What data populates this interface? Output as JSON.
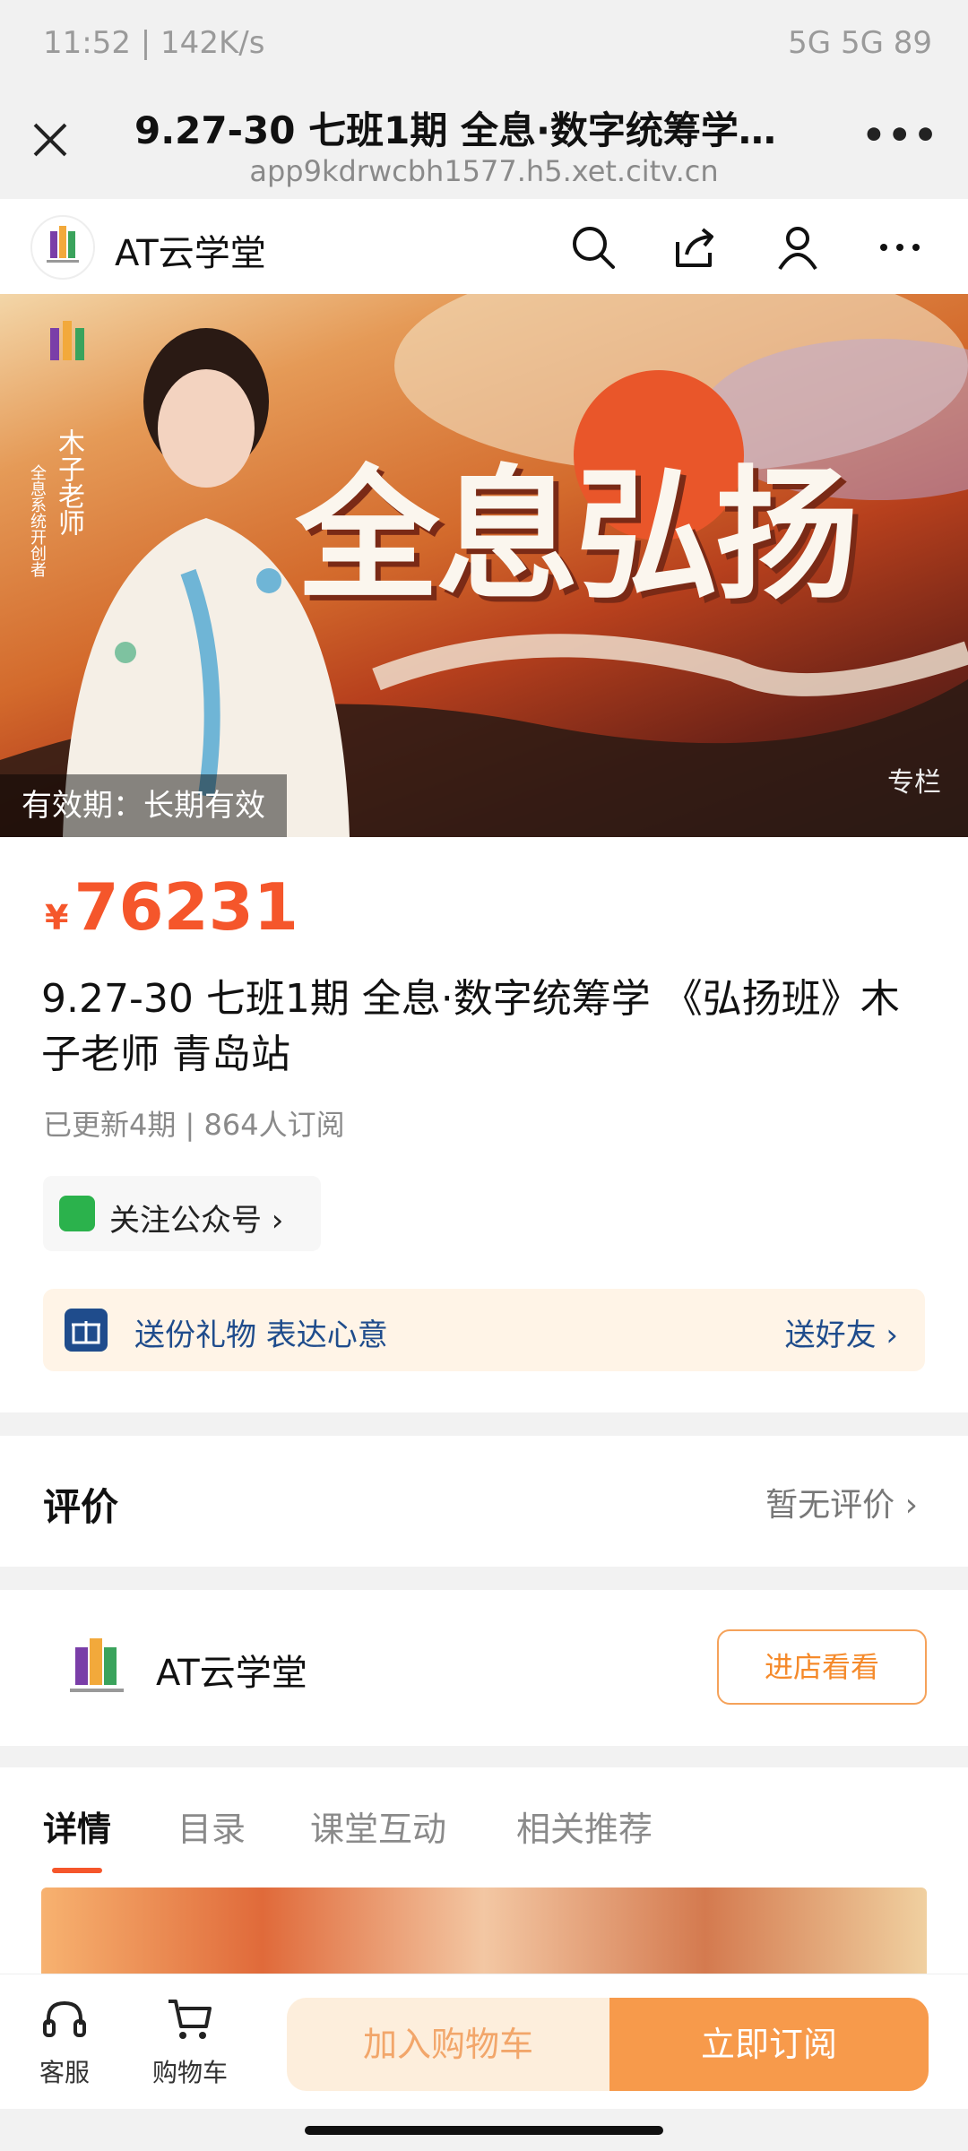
{
  "status_bar": {
    "left": "11:52 | 142K/s",
    "right": "5G 5G 89"
  },
  "browser": {
    "title": "9.27-30 七班1期 全息·数字统筹学…",
    "url": "app9kdrwcbh1577.h5.xet.citv.cn",
    "more_icon": "more-horizontal-icon"
  },
  "store": {
    "name": "AT云学堂",
    "icons": [
      "search-icon",
      "share-icon",
      "user-icon",
      "more-icon"
    ]
  },
  "banner": {
    "teacher_name": "木子老师",
    "teacher_title": "全息系统开创者",
    "headline": "全息弘扬",
    "validity": "有效期：长期有效",
    "badge": "专栏"
  },
  "product": {
    "price_symbol": "¥",
    "price": "76231",
    "title": "9.27-30 七班1期 全息·数字统筹学 《弘扬班》木子老师 青岛站",
    "meta": "已更新4期 | 864人订阅",
    "follow_label": "关注公众号 ›",
    "gift_text": "送份礼物 表达心意",
    "gift_action": "送好友 ›"
  },
  "review": {
    "title": "评价",
    "value": "暂无评价  ›"
  },
  "shop": {
    "name": "AT云学堂",
    "button": "进店看看"
  },
  "tabs": [
    "详情",
    "目录",
    "课堂互动",
    "相关推荐"
  ],
  "bottom": {
    "service_label": "客服",
    "cart_label": "购物车",
    "add_cart": "加入购物车",
    "subscribe": "立即订阅"
  },
  "colors": {
    "accent": "#f5562b",
    "orange_button": "#f79a4b",
    "gift_bg": "#fff4e7",
    "gift_text": "#1f4c8c"
  }
}
